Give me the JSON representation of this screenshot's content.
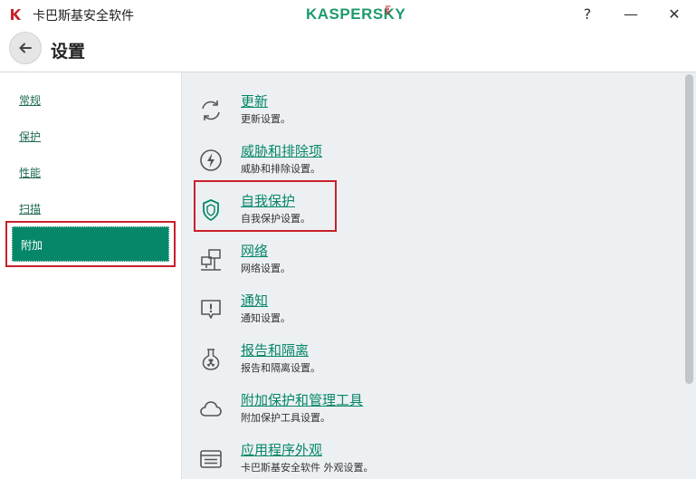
{
  "window": {
    "title": "卡巴斯基安全软件",
    "brand": "KASPERSKY",
    "brand_lab": "lab",
    "help_label": "?",
    "minimize_label": "—",
    "close_label": "✕"
  },
  "header": {
    "title": "设置"
  },
  "sidebar": {
    "items": [
      {
        "label": "常规"
      },
      {
        "label": "保护"
      },
      {
        "label": "性能"
      },
      {
        "label": "扫描"
      },
      {
        "label": "附加",
        "selected": true
      }
    ]
  },
  "main": {
    "entries": [
      {
        "title": "更新",
        "subtitle": "更新设置。",
        "icon": "refresh-icon"
      },
      {
        "title": "威胁和排除项",
        "subtitle": "威胁和排除设置。",
        "icon": "lightning-icon"
      },
      {
        "title": "自我保护",
        "subtitle": "自我保护设置。",
        "icon": "shield-icon"
      },
      {
        "title": "网络",
        "subtitle": "网络设置。",
        "icon": "network-icon"
      },
      {
        "title": "通知",
        "subtitle": "通知设置。",
        "icon": "notification-icon"
      },
      {
        "title": "报告和隔离",
        "subtitle": "报告和隔离设置。",
        "icon": "flask-icon"
      },
      {
        "title": "附加保护和管理工具",
        "subtitle": "附加保护工具设置。",
        "icon": "cloud-icon"
      },
      {
        "title": "应用程序外观",
        "subtitle": "卡巴斯基安全软件 外观设置。",
        "icon": "appearance-icon"
      }
    ]
  },
  "colors": {
    "accent": "#06876a",
    "highlight_border": "#c8202c",
    "main_bg": "#edf0f2"
  }
}
